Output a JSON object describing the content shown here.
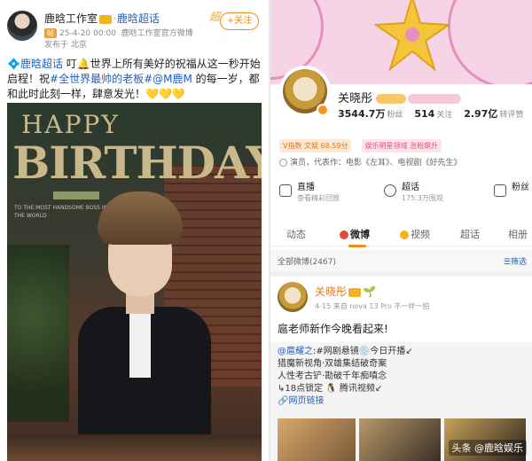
{
  "left_post": {
    "account_name": "鹿晗工作室",
    "topic": "鹿晗超话",
    "follow_label": "+关注",
    "brand_mark": "超",
    "tag": "帖",
    "time": "25-4-20 00:00",
    "source": "鹿晗工作室官方微博",
    "location": "发布于 北京",
    "text_topic": "鹿晗超话",
    "text_body": " 叮🔔世界上所有美好的祝福从这一秒开始启程！祝",
    "text_topic2": "#全世界最帅的老板#",
    "text_mention": "@M鹿M",
    "text_tail": " 的每一岁，都和此时此刻一样，肆意发光！",
    "hearts": "💛💛💛",
    "image": {
      "happy": "HAPPY",
      "birthday": "BIRTHDAY",
      "caption": "TO THE MOST HANDSOME BOSS IN THE WORLD"
    }
  },
  "profile": {
    "name": "关晓彤",
    "followers_value": "3544.7万",
    "followers_label": "粉丝",
    "following_value": "514",
    "following_label": "关注",
    "reposts_value": "2.97亿",
    "reposts_label": "转评赞",
    "badge1": "V指数 文娱 68.59分",
    "badge2": "娱乐明星领域 涨粉飙升",
    "info": "演员，代表作：电影《左耳》、电视剧《好先生》",
    "services": [
      {
        "title": "直播",
        "sub": "查看精彩回放"
      },
      {
        "title": "超话",
        "sub": "175.3万围观"
      },
      {
        "title": "粉丝",
        "sub": ""
      }
    ],
    "tabs": [
      "动态",
      "微博",
      "视频",
      "超话",
      "相册"
    ],
    "filter_left": "全部微博(2467)",
    "filter_right": "筛选"
  },
  "right_post": {
    "name": "关晓彤",
    "meta": "4-15  来自 nova 13 Pro 不一样一拍",
    "text": "扈老师新作今晚看起来!",
    "repost_author": "@扈耀之",
    "repost_lines": ":#网剧悬镜💿今日开播↙\n猎魔新视角·双雄集结破奇案\n人性考古铲·勘破千年痴嗔念\n↳18点锁定 🐧 腾讯视频↙",
    "repost_link": "网页链接",
    "watermark": "头条 @鹿晗娱乐"
  },
  "colors": {
    "accent": "#f08b1e",
    "link": "#1f5fbf",
    "pink": "#f6d4e6"
  }
}
